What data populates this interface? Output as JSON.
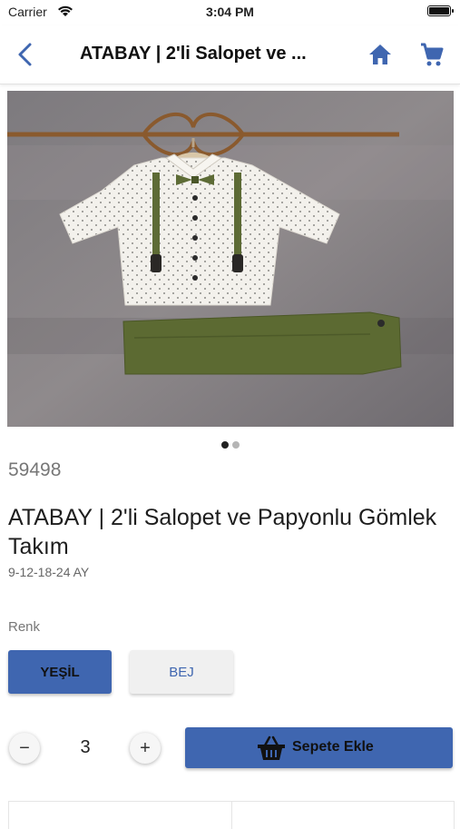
{
  "status_bar": {
    "carrier": "Carrier",
    "time": "3:04 PM"
  },
  "nav": {
    "title": "ATABAY | 2'li Salopet ve ...",
    "back_icon": "chevron-left-icon",
    "home_icon": "home-icon",
    "cart_icon": "cart-icon"
  },
  "gallery": {
    "image_count": 2,
    "active_index": 0
  },
  "product": {
    "sku": "59498",
    "title": "ATABAY | 2'li Salopet ve Papyonlu Gömlek Takım",
    "sizes": "9-12-18-24 AY"
  },
  "color": {
    "label": "Renk",
    "options": [
      {
        "label": "YEŞİL",
        "selected": true
      },
      {
        "label": "BEJ",
        "selected": false
      }
    ]
  },
  "quantity": {
    "value": "3",
    "minus": "−",
    "plus": "+"
  },
  "add_to_cart": {
    "label": "Sepete Ekle"
  },
  "colors": {
    "accent": "#3f66b0",
    "unselected_bg": "#f0f0f0"
  }
}
